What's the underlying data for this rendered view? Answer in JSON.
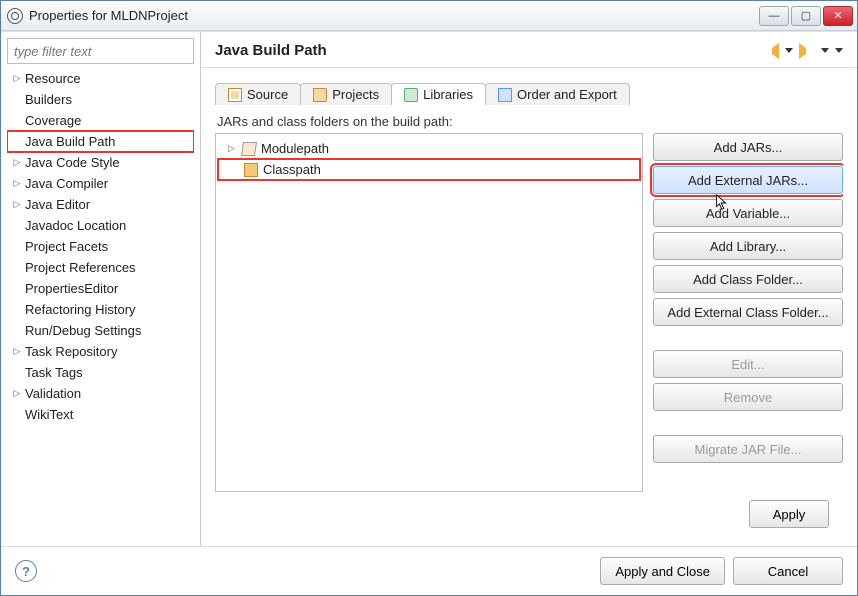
{
  "window": {
    "title": "Properties for MLDNProject"
  },
  "filter": {
    "placeholder": "type filter text"
  },
  "sidebar": {
    "items": [
      {
        "label": "Resource",
        "expandable": true
      },
      {
        "label": "Builders",
        "expandable": false
      },
      {
        "label": "Coverage",
        "expandable": false
      },
      {
        "label": "Java Build Path",
        "expandable": false,
        "selected": true
      },
      {
        "label": "Java Code Style",
        "expandable": true
      },
      {
        "label": "Java Compiler",
        "expandable": true
      },
      {
        "label": "Java Editor",
        "expandable": true
      },
      {
        "label": "Javadoc Location",
        "expandable": false
      },
      {
        "label": "Project Facets",
        "expandable": false
      },
      {
        "label": "Project References",
        "expandable": false
      },
      {
        "label": "PropertiesEditor",
        "expandable": false
      },
      {
        "label": "Refactoring History",
        "expandable": false
      },
      {
        "label": "Run/Debug Settings",
        "expandable": false
      },
      {
        "label": "Task Repository",
        "expandable": true
      },
      {
        "label": "Task Tags",
        "expandable": false
      },
      {
        "label": "Validation",
        "expandable": true
      },
      {
        "label": "WikiText",
        "expandable": false
      }
    ]
  },
  "main": {
    "heading": "Java Build Path",
    "tabs": {
      "source": "Source",
      "projects": "Projects",
      "libraries": "Libraries",
      "order": "Order and Export"
    },
    "listDesc": "JARs and class folders on the build path:",
    "nodes": {
      "modulepath": "Modulepath",
      "classpath": "Classpath"
    },
    "buttons": {
      "addJars": "Add JARs...",
      "addExternalJars": "Add External JARs...",
      "addVariable": "Add Variable...",
      "addLibrary": "Add Library...",
      "addClassFolder": "Add Class Folder...",
      "addExternalClassFolder": "Add External Class Folder...",
      "edit": "Edit...",
      "remove": "Remove",
      "migrate": "Migrate JAR File..."
    },
    "apply": "Apply"
  },
  "footer": {
    "applyClose": "Apply and Close",
    "cancel": "Cancel"
  }
}
